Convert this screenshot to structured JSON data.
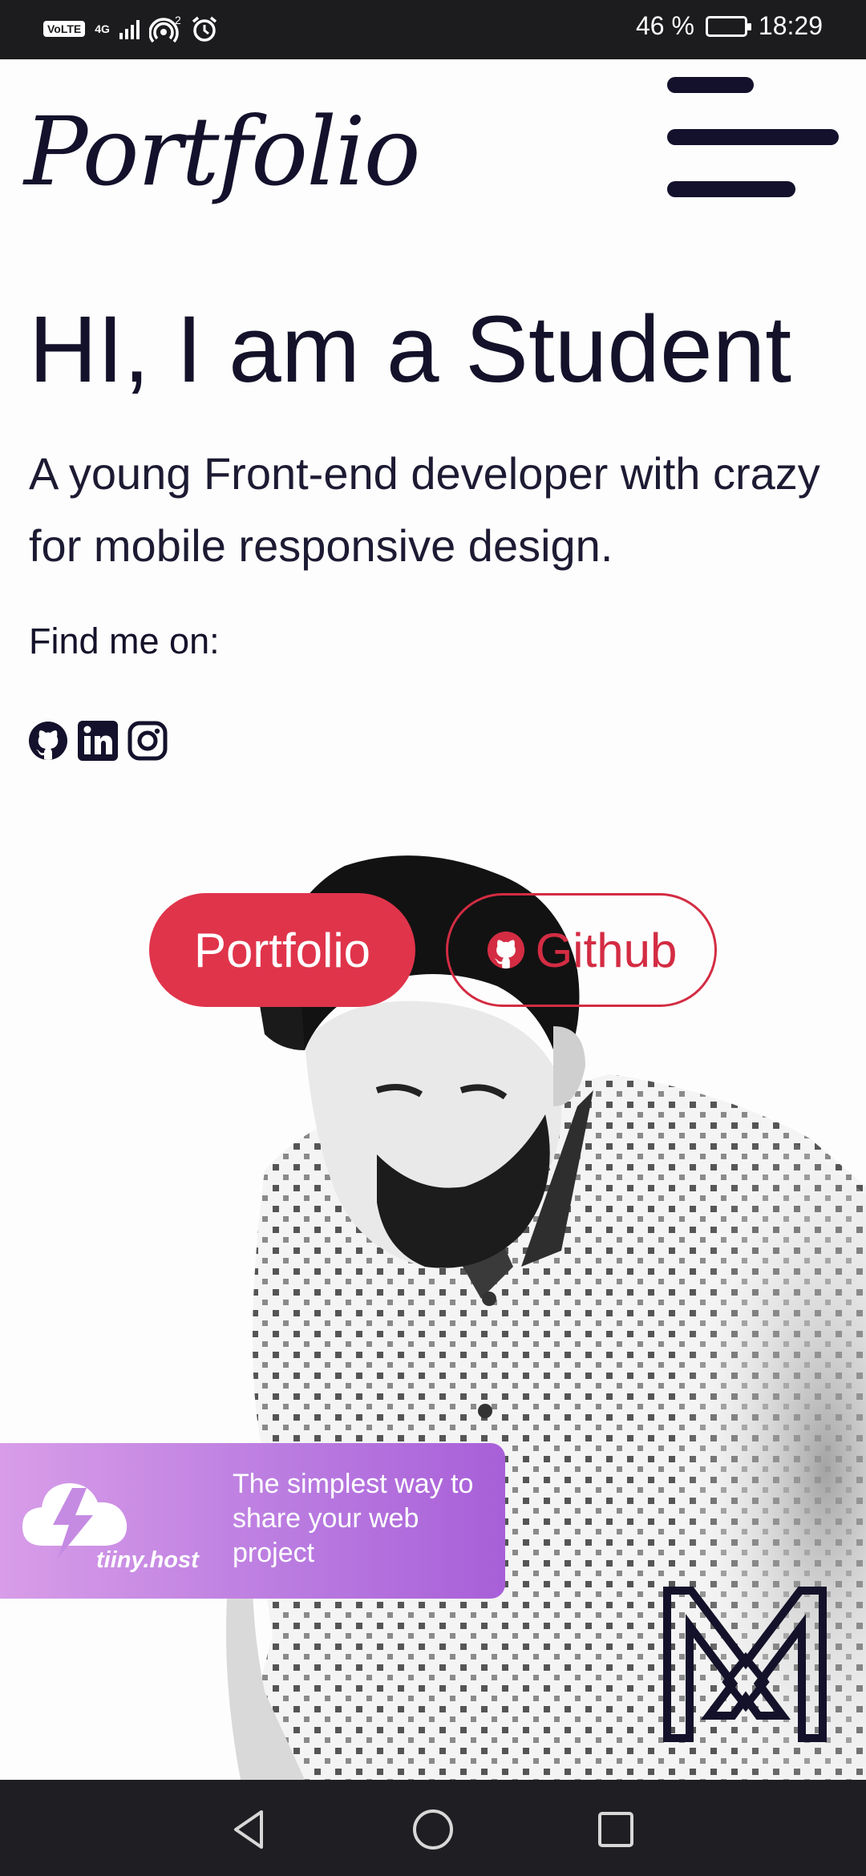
{
  "status_bar": {
    "carrier_badge": "VoLTE",
    "network": "4G",
    "hotspot_count": "2",
    "battery": "46 %",
    "battery_level": 0.46,
    "time": "18:29"
  },
  "header": {
    "brand": "Portfolio",
    "menu_icon": "hamburger-menu-icon"
  },
  "hero": {
    "title": "HI, I am a Student",
    "subtitle_prefix": "A young ",
    "subtitle_bold": "Front-end",
    "subtitle_suffix": " developer with crazy for mobile responsive design.",
    "find_me": "Find me on:",
    "socials": [
      {
        "icon": "github-icon"
      },
      {
        "icon": "linkedin-icon"
      },
      {
        "icon": "instagram-icon"
      }
    ]
  },
  "buttons": {
    "primary_label": "Portfolio",
    "secondary_label": "Github",
    "secondary_icon": "github-icon"
  },
  "banner": {
    "text": "The simplest way to share your web project",
    "brand": "tiiny.host",
    "icon": "cloud-lightning-icon"
  },
  "colors": {
    "accent": "#e0344b",
    "text": "#14122a",
    "banner": "#b97ae0"
  },
  "nav": {
    "back_icon": "back-triangle-icon",
    "home_icon": "home-circle-icon",
    "recents_icon": "recents-square-icon"
  }
}
